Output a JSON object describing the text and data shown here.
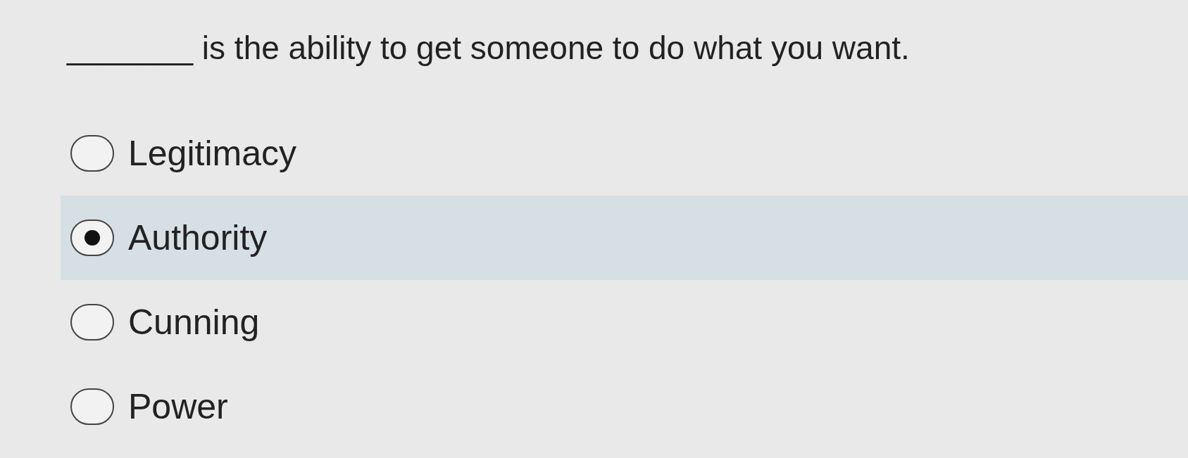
{
  "question": "_______ is the ability to get someone to do what you want.",
  "options": [
    {
      "label": "Legitimacy",
      "selected": false
    },
    {
      "label": "Authority",
      "selected": true
    },
    {
      "label": "Cunning",
      "selected": false
    },
    {
      "label": "Power",
      "selected": false
    }
  ]
}
